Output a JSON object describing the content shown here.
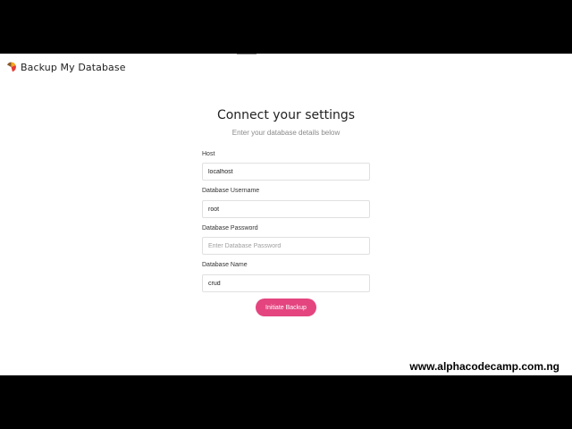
{
  "app": {
    "brand": "Backup My Database",
    "logo_icon": "pie-chart-logo-icon",
    "logo_colors": [
      "#f5a623",
      "#e53935",
      "#8b5a2b"
    ]
  },
  "main": {
    "title": "Connect your settings",
    "subtitle": "Enter your database details below"
  },
  "form": {
    "host": {
      "label": "Host",
      "value": "localhost",
      "placeholder": ""
    },
    "username": {
      "label": "Database Username",
      "value": "root",
      "placeholder": ""
    },
    "password": {
      "label": "Database Password",
      "value": "",
      "placeholder": "Enter Database Password"
    },
    "dbname": {
      "label": "Database Name",
      "value": "crud",
      "placeholder": ""
    },
    "submit_label": "Initiate Backup",
    "submit_color": "#e4457f"
  },
  "watermark": "www.alphacodecamp.com.ng"
}
